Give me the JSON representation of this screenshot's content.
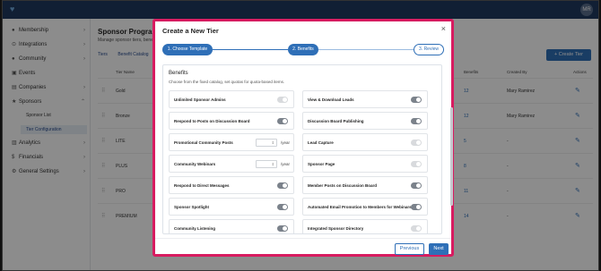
{
  "topbar": {
    "avatar": "MR"
  },
  "sidebar": {
    "items": [
      {
        "label": "Membership",
        "icon": "person-icon",
        "chevron": "›"
      },
      {
        "label": "Integrations",
        "icon": "plug-icon",
        "chevron": "›"
      },
      {
        "label": "Community",
        "icon": "people-icon",
        "chevron": "›"
      },
      {
        "label": "Events",
        "icon": "calendar-icon",
        "chevron": ""
      },
      {
        "label": "Companies",
        "icon": "building-icon",
        "chevron": "›"
      },
      {
        "label": "Sponsors",
        "icon": "star-icon",
        "chevron": "⌃"
      },
      {
        "label": "Analytics",
        "icon": "chart-icon",
        "chevron": "›"
      },
      {
        "label": "Financials",
        "icon": "dollar-icon",
        "chevron": "›"
      },
      {
        "label": "General Settings",
        "icon": "gear-icon",
        "chevron": "›"
      }
    ],
    "sub_items": [
      {
        "label": "Sponsor List"
      },
      {
        "label": "Tier Configuration"
      }
    ]
  },
  "main": {
    "title": "Sponsor Program",
    "subtitle": "Manage sponsor tiers, bene",
    "tabs": [
      "Tiers",
      "Benefit Catalog"
    ],
    "create_button": "+ Create Tier",
    "columns": {
      "tier_name": "Tier Name",
      "benefits": "Benefits",
      "created_by": "Created By",
      "actions": "Actions"
    },
    "rows": [
      {
        "name": "Gold",
        "benefits": "12",
        "created_by": "Mary Ramirez"
      },
      {
        "name": "Bronze",
        "benefits": "12",
        "created_by": "Mary Ramirez"
      },
      {
        "name": "LITE",
        "benefits": "5",
        "created_by": "-"
      },
      {
        "name": "PLUS",
        "benefits": "8",
        "created_by": "-"
      },
      {
        "name": "PRO",
        "benefits": "11",
        "created_by": "-"
      },
      {
        "name": "PREMIUM",
        "benefits": "14",
        "created_by": "-"
      }
    ]
  },
  "modal": {
    "title": "Create a New Tier",
    "close": "×",
    "steps": [
      "1. Choose Template",
      "2. Benefits",
      "3. Review"
    ],
    "benefits_title": "Benefits",
    "benefits_subtitle": "Choose from the fixed catalog, set quotas for quota-based items.",
    "per_year": "/year",
    "cards_left": [
      {
        "label": "Unlimited Sponsor Admins",
        "toggle": "off"
      },
      {
        "label": "Respond to Posts on Discussion Board",
        "toggle": "on"
      },
      {
        "label": "Promotional Community Posts",
        "toggle": "quota",
        "quota": "0"
      },
      {
        "label": "Community Webinars",
        "toggle": "quota",
        "quota": "0"
      },
      {
        "label": "Respond to Direct Messages",
        "toggle": "on"
      },
      {
        "label": "Sponsor Spotlight",
        "toggle": "on"
      },
      {
        "label": "Community Listening",
        "toggle": "on"
      }
    ],
    "cards_right": [
      {
        "label": "View & Download Leads",
        "toggle": "on"
      },
      {
        "label": "Discussion Board Publishing",
        "toggle": "on"
      },
      {
        "label": "Lead Capture",
        "toggle": "off"
      },
      {
        "label": "Sponsor Page",
        "toggle": "off"
      },
      {
        "label": "Member Posts on Discussion Board",
        "toggle": "on"
      },
      {
        "label": "Automated Email Promotion to Members for Webinars",
        "toggle": "on"
      },
      {
        "label": "Integrated Sponsor Directory",
        "toggle": "off"
      }
    ],
    "previous_button": "Previous",
    "next_button": "Next"
  }
}
